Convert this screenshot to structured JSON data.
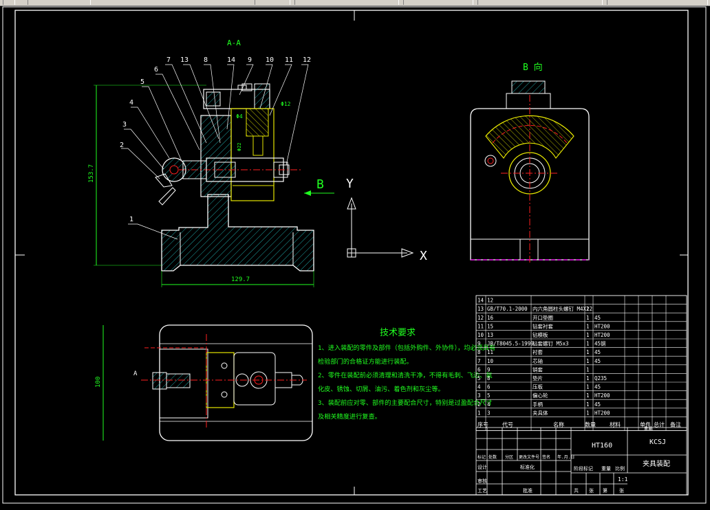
{
  "view_labels": {
    "section_aa": "A-A",
    "view_b": "B 向",
    "arrow_b": "B",
    "arrow_a": "A",
    "axis_x": "X",
    "axis_y": "Y"
  },
  "dimensions": {
    "height": "153.7",
    "width": "129.7",
    "plan_height": "100",
    "bore": "Φ12",
    "hole": "Φ4",
    "small": "Φ22"
  },
  "callouts": [
    "1",
    "2",
    "3",
    "4",
    "5",
    "6",
    "7",
    "13",
    "8",
    "14",
    "9",
    "10",
    "11",
    "12"
  ],
  "tech_req": {
    "title": "技术要求",
    "lines": [
      "1、进入装配的零件及部件（包括外购件、外协件），均必须具有",
      "检验部门的合格证方能进行装配。",
      "2、零件在装配前必须清理和清洗干净，不得有毛刺、飞边、氧",
      "化皮、锈蚀、切屑、油污、着色剂和灰尘等。",
      "3、装配前应对零、部件的主要配合尺寸，特别是过盈配合尺寸",
      "及相关精度进行复查。"
    ]
  },
  "bom": {
    "rows": [
      {
        "no": "14",
        "code": "12",
        "name": "",
        "qty": "",
        "mat": ""
      },
      {
        "no": "13",
        "code": "GB/T70.1-2000",
        "name": "内六角圆柱头螺钉 M4X12",
        "qty": "2",
        "mat": ""
      },
      {
        "no": "12",
        "code": "16",
        "name": "开口垫圈",
        "qty": "1",
        "mat": "45"
      },
      {
        "no": "11",
        "code": "15",
        "name": "钻套衬套",
        "qty": "1",
        "mat": "HT200"
      },
      {
        "no": "10",
        "code": "13",
        "name": "钻模板",
        "qty": "1",
        "mat": "HT200"
      },
      {
        "no": "9",
        "code": "JB/T8045.5-1999",
        "name": "钻套螺钉 M5x3",
        "qty": "1",
        "mat": "45钢"
      },
      {
        "no": "8",
        "code": "11",
        "name": "衬套",
        "qty": "1",
        "mat": "45"
      },
      {
        "no": "7",
        "code": "10",
        "name": "芯轴",
        "qty": "1",
        "mat": "45"
      },
      {
        "no": "6",
        "code": "9",
        "name": "销套",
        "qty": "1",
        "mat": ""
      },
      {
        "no": "5",
        "code": "8",
        "name": "垫片",
        "qty": "1",
        "mat": "Q235"
      },
      {
        "no": "4",
        "code": "6",
        "name": "压板",
        "qty": "1",
        "mat": "45"
      },
      {
        "no": "3",
        "code": "5",
        "name": "偏心轮",
        "qty": "1",
        "mat": "HT200"
      },
      {
        "no": "2",
        "code": "4",
        "name": "手柄",
        "qty": "1",
        "mat": "45"
      },
      {
        "no": "1",
        "code": "3",
        "name": "夹具体",
        "qty": "1",
        "mat": "HT200"
      }
    ],
    "header": {
      "seq": "序号",
      "code": "代号",
      "name": "名称",
      "qty": "数量",
      "mat": "材料",
      "unit_w": "单件",
      "total_w": "总计",
      "weight": "重量",
      "remark": "备注"
    }
  },
  "title_block": {
    "material": "HT160",
    "company": "KCSJ",
    "drawing_name": "夹具装配",
    "scale": "1:1",
    "rev_cols": [
      "标记",
      "处数",
      "分区",
      "更改文件号",
      "签名",
      "年.月.日"
    ],
    "roles": [
      "设计",
      "标准化",
      "审核",
      "工艺",
      "批准"
    ],
    "stage_cols": [
      "阶段标记",
      "重量",
      "比例"
    ],
    "sheet_cols": [
      "共",
      "张",
      "第",
      "张"
    ]
  },
  "colors": {
    "outline": "#ffffff",
    "yellow": "#e6e600",
    "red": "#ff2020",
    "green": "#20ff20",
    "cyan": "#00e5e5",
    "hatch": "#1fa3a3",
    "magenta": "#ff00ff"
  }
}
